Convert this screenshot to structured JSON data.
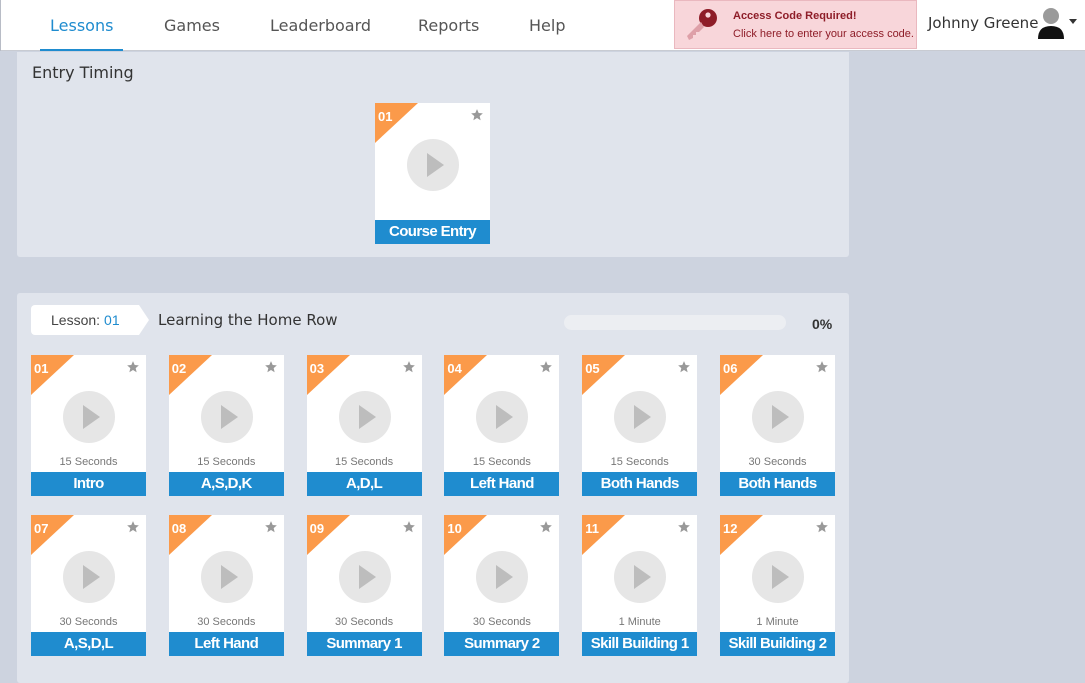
{
  "nav": {
    "items": [
      {
        "label": "Lessons",
        "active": true
      },
      {
        "label": "Games",
        "active": false
      },
      {
        "label": "Leaderboard",
        "active": false
      },
      {
        "label": "Reports",
        "active": false
      },
      {
        "label": "Help",
        "active": false
      }
    ]
  },
  "access": {
    "title": "Access Code Required!",
    "subtitle": "Click here to enter your access code.",
    "icon": "key-icon",
    "color": "#8e1d28"
  },
  "user": {
    "name": "Johnny Greene",
    "icon": "user-icon"
  },
  "entry_section": {
    "title": "Entry Timing",
    "card": {
      "number": "01",
      "label": "Course Entry"
    }
  },
  "lesson_section": {
    "lesson_label": "Lesson:",
    "lesson_number": "01",
    "title": "Learning the Home Row",
    "progress_text": "0%",
    "progress_value": 0,
    "cards": [
      {
        "number": "01",
        "duration": "15 Seconds",
        "label": "Intro"
      },
      {
        "number": "02",
        "duration": "15 Seconds",
        "label": "A,S,D,K"
      },
      {
        "number": "03",
        "duration": "15 Seconds",
        "label": "A,D,L"
      },
      {
        "number": "04",
        "duration": "15 Seconds",
        "label": "Left Hand"
      },
      {
        "number": "05",
        "duration": "15 Seconds",
        "label": "Both Hands"
      },
      {
        "number": "06",
        "duration": "30 Seconds",
        "label": "Both Hands"
      },
      {
        "number": "07",
        "duration": "30 Seconds",
        "label": "A,S,D,L"
      },
      {
        "number": "08",
        "duration": "30 Seconds",
        "label": "Left Hand"
      },
      {
        "number": "09",
        "duration": "30 Seconds",
        "label": "Summary 1"
      },
      {
        "number": "10",
        "duration": "30 Seconds",
        "label": "Summary 2"
      },
      {
        "number": "11",
        "duration": "1 Minute",
        "label": "Skill Building 1"
      },
      {
        "number": "12",
        "duration": "1 Minute",
        "label": "Skill Building 2"
      }
    ]
  },
  "colors": {
    "accent": "#1f8ccf",
    "badge": "#fb9a4a",
    "panel": "#e0e4ec",
    "background": "#cdd3df",
    "alert_background": "#f8d6da"
  }
}
